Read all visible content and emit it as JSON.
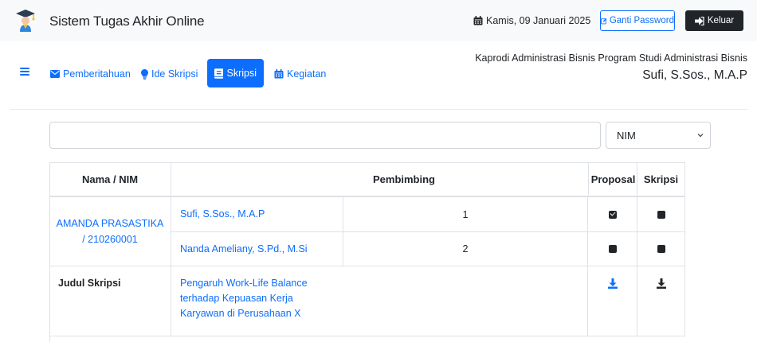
{
  "header": {
    "title": "Sistem Tugas Akhir Online",
    "date": "Kamis, 09 Januari 2025",
    "change_password_label": "Ganti Password",
    "logout_label": "Keluar"
  },
  "nav": {
    "items": [
      {
        "label": "Pemberitahuan",
        "icon": "envelope-icon",
        "active": false
      },
      {
        "label": "Ide Skripsi",
        "icon": "lightbulb-icon",
        "active": false
      },
      {
        "label": "Skripsi",
        "icon": "book-icon",
        "active": true
      },
      {
        "label": "Kegiatan",
        "icon": "calendar-icon",
        "active": false
      }
    ],
    "role": "Kaprodi Administrasi Bisnis Program Studi Administrasi Bisnis",
    "user_name": "Sufi, S.Sos., M.A.P"
  },
  "search": {
    "value": "",
    "placeholder": "",
    "filter_selected": "NIM"
  },
  "table": {
    "headers": {
      "student": "Nama / NIM",
      "advisor": "Pembimbing",
      "proposal": "Proposal",
      "thesis": "Skripsi"
    },
    "student": "AMANDA PRASASTIKA / 210260001",
    "advisors": [
      {
        "name": "Sufi, S.Sos., M.A.P",
        "order": "1",
        "proposal_checked": true,
        "thesis_checked": false
      },
      {
        "name": "Nanda Ameliany, S.Pd., M.Si",
        "order": "2",
        "proposal_checked": false,
        "thesis_checked": false
      }
    ],
    "title_label": "Judul Skripsi",
    "thesis_title": "Pengaruh Work-Life Balance terhadap Kepuasan Kerja Karyawan di Perusahaan X"
  },
  "colors": {
    "primary": "#0d6efd",
    "dark": "#212529",
    "topbar_bg": "#f8f9fa",
    "border": "#dee2e6"
  }
}
